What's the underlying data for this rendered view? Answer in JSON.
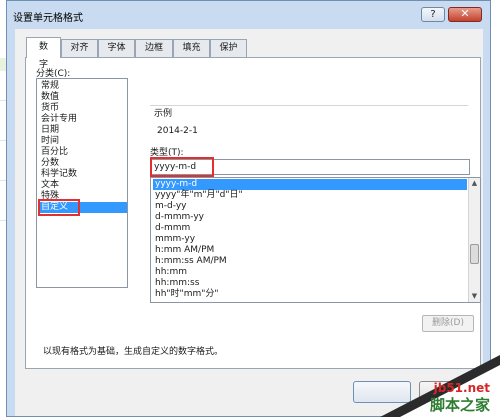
{
  "dialog": {
    "title": "设置单元格格式",
    "help_label": "?",
    "close_label": "✕"
  },
  "tabs": [
    {
      "label": "数字",
      "active": true
    },
    {
      "label": "对齐"
    },
    {
      "label": "字体"
    },
    {
      "label": "边框"
    },
    {
      "label": "填充"
    },
    {
      "label": "保护"
    }
  ],
  "category": {
    "label": "分类(C):",
    "items": [
      "常规",
      "数值",
      "货币",
      "会计专用",
      "日期",
      "时间",
      "百分比",
      "分数",
      "科学记数",
      "文本",
      "特殊",
      "自定义"
    ],
    "selected": "自定义"
  },
  "sample": {
    "label": "示例",
    "value": "2014-2-1"
  },
  "type": {
    "label": "类型(T):",
    "value": "yyyy-m-d",
    "options": [
      "yyyy-m-d",
      "yyyy\"年\"m\"月\"d\"日\"",
      "m-d-yy",
      "d-mmm-yy",
      "d-mmm",
      "mmm-yy",
      "h:mm AM/PM",
      "h:mm:ss AM/PM",
      "hh:mm",
      "hh:mm:ss",
      "hh\"时\"mm\"分\""
    ],
    "selected": "yyyy-m-d"
  },
  "delete_button": "删除(D)",
  "description": "以现有格式为基础，生成自定义的数字格式。",
  "watermark": {
    "top": "jb51.net",
    "bottom": "脚本之家"
  },
  "colors": {
    "selection": "#3399ff",
    "highlight_box": "#e3302f",
    "close_button": "#c4412e"
  }
}
